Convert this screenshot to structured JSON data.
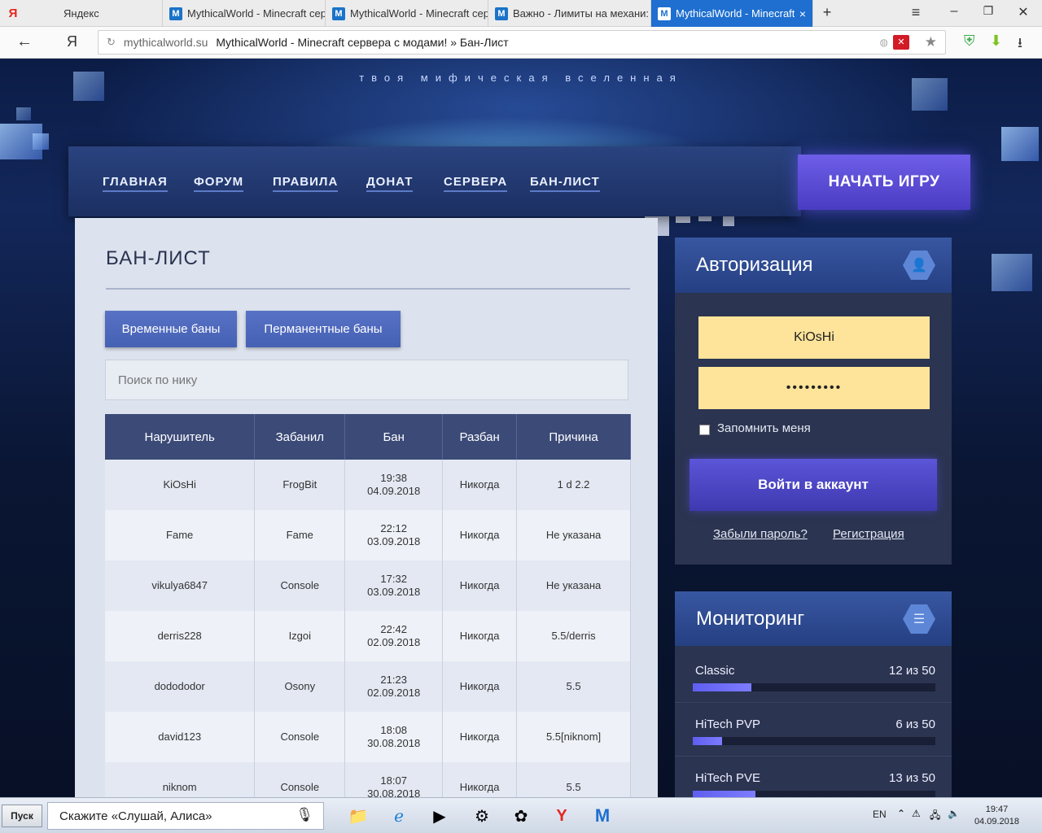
{
  "browser": {
    "tabs": [
      {
        "label": "Яндекс",
        "icon": "yandex-icon",
        "active": false
      },
      {
        "label": "MythicalWorld - Minecraft сер",
        "icon": "mythicalworld-icon",
        "active": false
      },
      {
        "label": "MythicalWorld - Minecraft сер",
        "icon": "mythicalworld-icon",
        "active": false
      },
      {
        "label": "Важно - Лимиты на механи:",
        "icon": "mythicalworld-icon",
        "active": false
      },
      {
        "label": "MythicalWorld - Minecraft",
        "icon": "mythicalworld-icon",
        "active": true
      }
    ],
    "new_tab": "+",
    "close_tab": "×",
    "address": {
      "domain": "mythicalworld.su",
      "title": "MythicalWorld - Minecraft сервера с модами! » Бан-Лист"
    },
    "yandex_letter": "Я",
    "fav_letter": "M"
  },
  "site": {
    "tagline": "твоя мифическая вселенная",
    "nav": [
      "ГЛАВНАЯ",
      "ФОРУМ",
      "ПРАВИЛА",
      "ДОНАТ",
      "СЕРВЕРА",
      "БАН-ЛИСТ"
    ],
    "start_game": "НАЧАТЬ ИГРУ"
  },
  "banlist": {
    "title": "БАН-ЛИСТ",
    "filters": [
      "Временные баны",
      "Перманентные баны"
    ],
    "search_placeholder": "Поиск по нику",
    "columns": [
      "Нарушитель",
      "Забанил",
      "Бан",
      "Разбан",
      "Причина"
    ],
    "rows": [
      {
        "player": "KiOsHi",
        "by": "FrogBit",
        "time": "19:38",
        "date": "04.09.2018",
        "unban": "Никогда",
        "reason": "1 d 2.2"
      },
      {
        "player": "Fame",
        "by": "Fame",
        "time": "22:12",
        "date": "03.09.2018",
        "unban": "Никогда",
        "reason": "Не указана"
      },
      {
        "player": "vikulya6847",
        "by": "Console",
        "time": "17:32",
        "date": "03.09.2018",
        "unban": "Никогда",
        "reason": "Не указана"
      },
      {
        "player": "derris228",
        "by": "Izgoi",
        "time": "22:42",
        "date": "02.09.2018",
        "unban": "Никогда",
        "reason": "5.5/derris"
      },
      {
        "player": "dodododor",
        "by": "Osony",
        "time": "21:23",
        "date": "02.09.2018",
        "unban": "Никогда",
        "reason": "5.5"
      },
      {
        "player": "david123",
        "by": "Console",
        "time": "18:08",
        "date": "30.08.2018",
        "unban": "Никогда",
        "reason": "5.5[niknom]"
      },
      {
        "player": "niknom",
        "by": "Console",
        "time": "18:07",
        "date": "30.08.2018",
        "unban": "Никогда",
        "reason": "5.5"
      }
    ]
  },
  "auth": {
    "title": "Авторизация",
    "username": "KiOsHi",
    "password_mask": "•••••••••",
    "remember": "Запомнить меня",
    "login": "Войти в аккаунт",
    "forgot": "Забыли пароль?",
    "register": "Регистрация"
  },
  "monitoring": {
    "title": "Мониторинг",
    "servers": [
      {
        "name": "Classic",
        "count": "12 из 50",
        "load": 0.24
      },
      {
        "name": "HiTech PVP",
        "count": "6 из 50",
        "load": 0.12
      },
      {
        "name": "HiTech PVE",
        "count": "13 из 50",
        "load": 0.26
      }
    ]
  },
  "taskbar": {
    "start": "Пуск",
    "alice": "Скажите «Слушай, Алиса»",
    "lang": "EN",
    "time": "19:47",
    "date": "04.09.2018"
  },
  "colors": {
    "accent": "#1e6fd0",
    "button": "#4a62b8",
    "field": "#fde49a",
    "panel": "#2b3450"
  }
}
